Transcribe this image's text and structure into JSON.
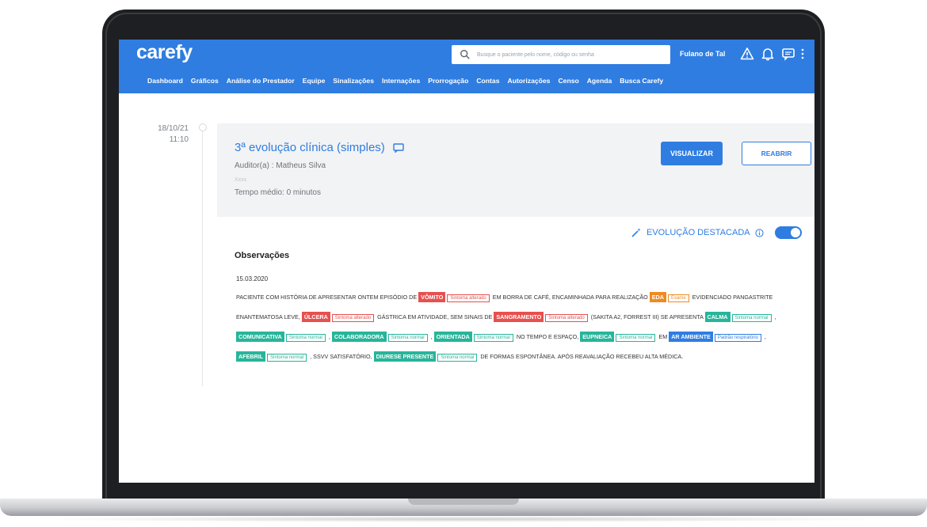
{
  "app": {
    "logo": "carefy",
    "search_placeholder": "Busque o paciente pelo nome, código ou senha",
    "user_name": "Fulano de Tal"
  },
  "nav": [
    {
      "label": "Dashboard"
    },
    {
      "label": "Gráficos"
    },
    {
      "label": "Análise do Prestador"
    },
    {
      "label": "Equipe"
    },
    {
      "label": "Sinalizações"
    },
    {
      "label": "Internações"
    },
    {
      "label": "Prorrogação"
    },
    {
      "label": "Contas"
    },
    {
      "label": "Autorizações"
    },
    {
      "label": "Censo"
    },
    {
      "label": "Agenda"
    },
    {
      "label": "Busca Carefy"
    }
  ],
  "entry": {
    "date": "18/10/21",
    "time": "11:10",
    "title": "3ª evolução clínica (simples)",
    "author": "Auditor(a) : Matheus Silva",
    "mini_label": "Xxxx",
    "avg_time": "Tempo médio: 0 minutos",
    "view_button": "VISUALIZAR",
    "reopen_button": "REABRIR"
  },
  "highlight": {
    "label": "EVOLUÇÃO DESTACADA",
    "toggle_on": true
  },
  "observations": {
    "title": "Observações",
    "date": "15.03.2020",
    "segments": [
      {
        "text": "PACIENTE COM HISTÓRIA DE APRESENTAR ONTEM EPISÓDIO DE"
      },
      {
        "tag": "VÔMITO",
        "label": "Sintoma alterado",
        "kind": "red"
      },
      {
        "text": "EM BORRA DE CAFÉ, ENCAMINHADA PARA REALIZAÇÃO"
      },
      {
        "tag": "EDA",
        "label": "Exame",
        "kind": "orange"
      },
      {
        "text": "EVIDENCIADO PANGASTRITE ENANTEMATOSA LEVE,"
      },
      {
        "tag": "ÚLCERA",
        "label": "Sintoma alterado",
        "kind": "red"
      },
      {
        "text": "GÁSTRICA EM ATIVIDADE, SEM SINAIS DE"
      },
      {
        "tag": "SANGRAMENTO",
        "label": "Sintoma alterado",
        "kind": "red"
      },
      {
        "text": "(SAKITA A2, FORREST III) SE APRESENTA"
      },
      {
        "tag": "CALMA",
        "label": "Sintoma normal",
        "kind": "teal"
      },
      {
        "text": ","
      },
      {
        "tag": "COMUNICATIVA",
        "label": "Sintoma normal",
        "kind": "teal"
      },
      {
        "text": ","
      },
      {
        "tag": "COLABORADORA",
        "label": "Sintoma normal",
        "kind": "teal"
      },
      {
        "text": ","
      },
      {
        "tag": "ORIENTADA",
        "label": "Sintoma normal",
        "kind": "teal"
      },
      {
        "text": "NO TEMPO E ESPAÇO,"
      },
      {
        "tag": "EUPNEICA",
        "label": "Sintoma normal",
        "kind": "teal"
      },
      {
        "text": "EM"
      },
      {
        "tag": "AR AMBIENTE",
        "label": "Padrão respiratório",
        "kind": "blue"
      },
      {
        "text": ","
      },
      {
        "tag": "AFEBRIL",
        "label": "Sintoma normal",
        "kind": "teal"
      },
      {
        "text": ", SSVV SATISFATÓRIO,"
      },
      {
        "tag": "DIURESE PRESENTE",
        "label": "Sintoma normal",
        "kind": "teal"
      },
      {
        "text": "DE FORMAS ESPONTÂNEA. APÓS REAVALIAÇÃO RECEBEU ALTA MÉDICA."
      }
    ]
  }
}
